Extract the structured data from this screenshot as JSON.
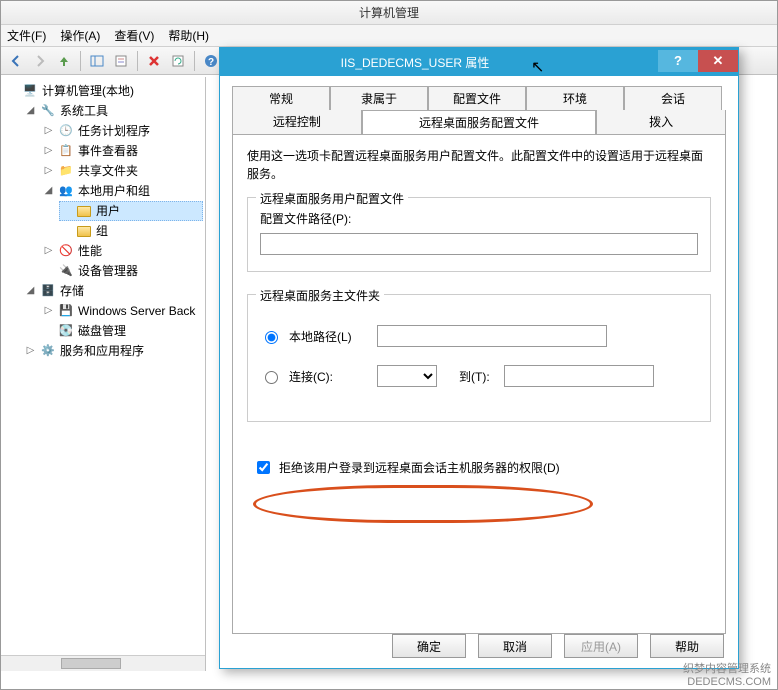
{
  "window": {
    "title": "计算机管理"
  },
  "menu": {
    "file": "文件(F)",
    "action": "操作(A)",
    "view": "查看(V)",
    "help": "帮助(H)"
  },
  "tree": {
    "root": "计算机管理(本地)",
    "systools": "系统工具",
    "taskScheduler": "任务计划程序",
    "eventViewer": "事件查看器",
    "sharedFolders": "共享文件夹",
    "localUsersGroups": "本地用户和组",
    "users": "用户",
    "groups": "组",
    "performance": "性能",
    "deviceManager": "设备管理器",
    "storage": "存储",
    "wsb": "Windows Server Back",
    "diskMgmt": "磁盘管理",
    "services": "服务和应用程序"
  },
  "dialog": {
    "title": "IIS_DEDECMS_USER 属性",
    "tabs": {
      "general": "常规",
      "memberOf": "隶属于",
      "profile": "配置文件",
      "environment": "环境",
      "sessions": "会话",
      "remoteControl": "远程控制",
      "rdsProfile": "远程桌面服务配置文件",
      "dialin": "拨入"
    },
    "intro": "使用这一选项卡配置远程桌面服务用户配置文件。此配置文件中的设置适用于远程桌面服务。",
    "group1": {
      "legend": "远程桌面服务用户配置文件",
      "pathLabel": "配置文件路径(P):",
      "pathValue": ""
    },
    "group2": {
      "legend": "远程桌面服务主文件夹",
      "localLabel": "本地路径(L)",
      "localValue": "",
      "connectLabel": "连接(C):",
      "connectDrive": "",
      "toLabel": "到(T):",
      "toValue": ""
    },
    "deny": "拒绝该用户登录到远程桌面会话主机服务器的权限(D)",
    "buttons": {
      "ok": "确定",
      "cancel": "取消",
      "apply": "应用(A)",
      "help": "帮助"
    }
  },
  "watermark": {
    "line1": "织梦内容管理系统",
    "line2": "DEDECMS.COM"
  }
}
